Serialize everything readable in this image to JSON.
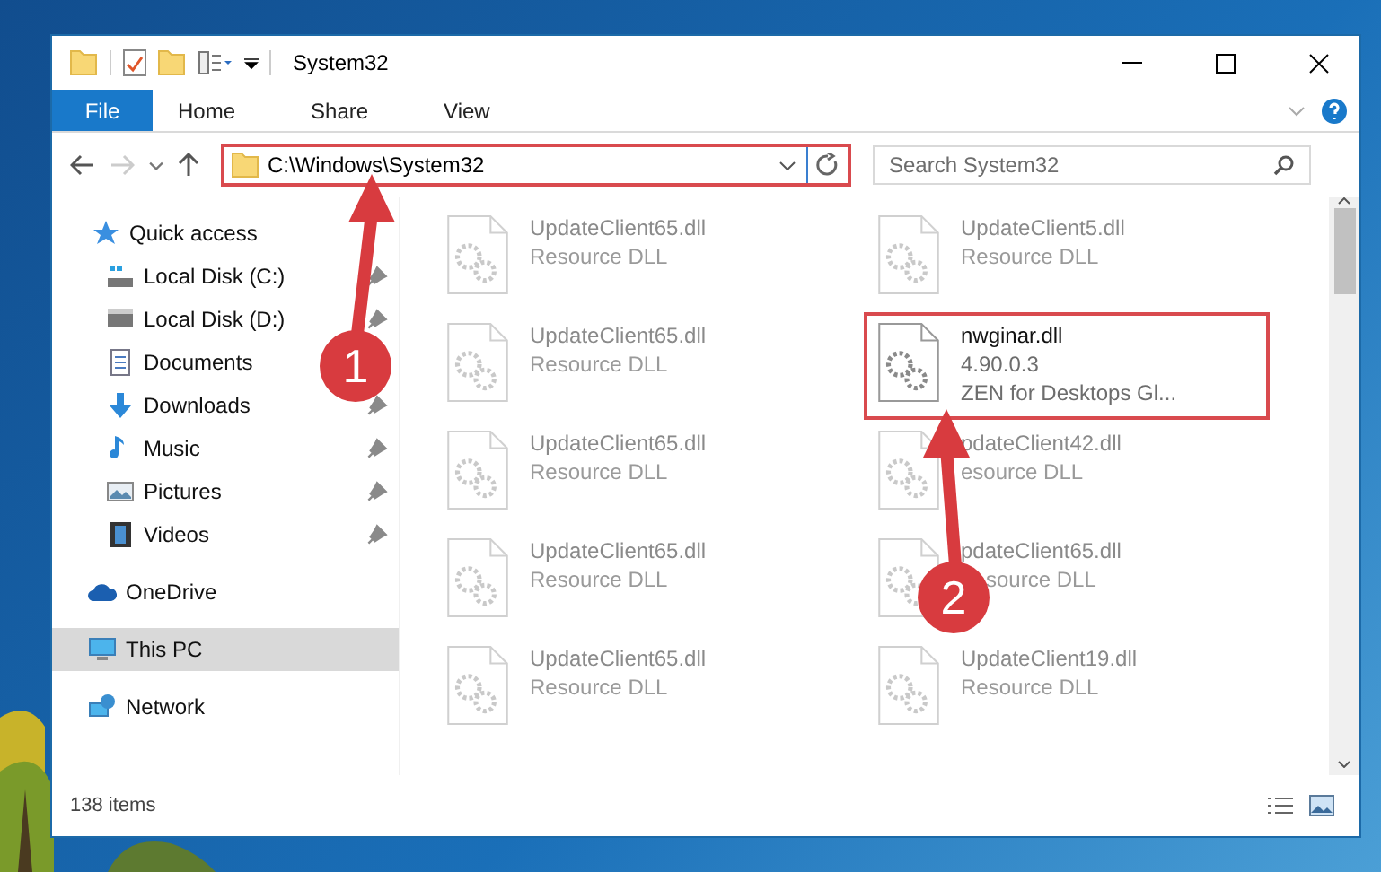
{
  "window": {
    "title": "System32"
  },
  "ribbon_tabs": [
    {
      "label": "File",
      "kind": "file"
    },
    {
      "label": "Home",
      "kind": "tab"
    },
    {
      "label": "Share",
      "kind": "tab"
    },
    {
      "label": "View",
      "kind": "tab"
    }
  ],
  "address_bar": {
    "path": "C:\\Windows\\System32",
    "highlighted": true
  },
  "search": {
    "placeholder": "Search System32"
  },
  "sidebar": {
    "items": [
      {
        "label": "Quick access",
        "selected": false,
        "children": [
          {
            "label": "Local Disk (C:)",
            "pinned": true,
            "selected": false
          },
          {
            "label": "Local Disk (D:)",
            "pinned": true,
            "selected": false
          },
          {
            "label": "Documents",
            "selected": false
          },
          {
            "label": "Downloads",
            "pinned": true,
            "selected": false
          },
          {
            "label": "Music",
            "pinned": true,
            "selected": false
          },
          {
            "label": "Pictures",
            "pinned": true,
            "selected": false
          },
          {
            "label": "Videos",
            "pinned": true,
            "selected": false
          }
        ]
      },
      {
        "label": "OneDrive",
        "selected": false
      },
      {
        "label": "This PC",
        "selected": true
      },
      {
        "label": "Network",
        "selected": false
      }
    ]
  },
  "files": [
    {
      "name": "UpdateClient65.dll",
      "detail": "Resource DLL",
      "faded": true,
      "outlined": false
    },
    {
      "name": "UpdateClient5.dll",
      "detail": "Resource DLL",
      "faded": true,
      "outlined": false
    },
    {
      "name": "UpdateClient65.dll",
      "detail": "Resource DLL",
      "faded": true,
      "outlined": false
    },
    {
      "name": "nwginar.dll",
      "version": "4.90.0.3",
      "description": "ZEN for Desktops Gl...",
      "faded": false,
      "outlined": true
    },
    {
      "name": "UpdateClient65.dll",
      "detail": "Resource DLL",
      "faded": true,
      "outlined": false
    },
    {
      "name": "pdateClient42.dll",
      "detail": "esource DLL",
      "faded": true,
      "outlined": false
    },
    {
      "name": "UpdateClient65.dll",
      "detail": "Resource DLL",
      "faded": true,
      "outlined": false
    },
    {
      "name": "pdateClient65.dll",
      "detail": "source DLL",
      "faded": true,
      "outlined": false
    },
    {
      "name": "UpdateClient65.dll",
      "detail": "Resource DLL",
      "faded": true,
      "outlined": false
    },
    {
      "name": "UpdateClient19.dll",
      "detail": "Resource DLL",
      "faded": true,
      "outlined": false
    }
  ],
  "status_bar": {
    "count": "138 items"
  },
  "annotations": [
    {
      "label": "1"
    },
    {
      "label": "2"
    }
  ]
}
